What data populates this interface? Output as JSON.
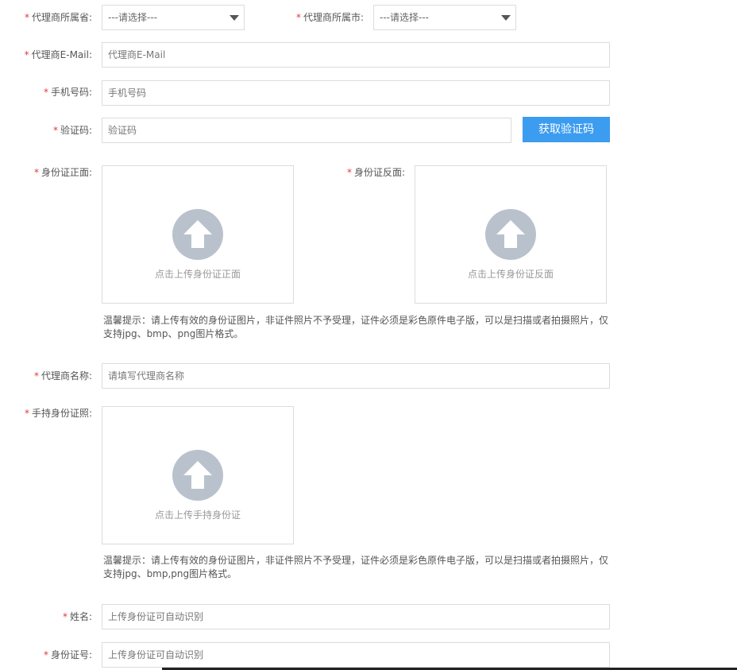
{
  "fields": {
    "province": {
      "label": "代理商所属省:",
      "value": "---请选择---"
    },
    "city": {
      "label": "代理商所属市:",
      "value": "---请选择---"
    },
    "email": {
      "label": "代理商E-Mail:",
      "placeholder": "代理商E-Mail"
    },
    "phone": {
      "label": "手机号码:",
      "placeholder": "手机号码"
    },
    "code": {
      "label": "验证码:",
      "placeholder": "验证码",
      "button": "获取验证码"
    },
    "id_front": {
      "label": "身份证正面:",
      "upload_text": "点击上传身份证正面"
    },
    "id_back": {
      "label": "身份证反面:",
      "upload_text": "点击上传身份证反面"
    },
    "hint1": "温馨提示：请上传有效的身份证图片，非证件照片不予受理，证件必须是彩色原件电子版，可以是扫描或者拍摄照片，仅支持jpg、bmp、png图片格式。",
    "agent_name": {
      "label": "代理商名称:",
      "placeholder": "请填写代理商名称"
    },
    "id_handheld": {
      "label": "手持身份证照:",
      "upload_text": "点击上传手持身份证"
    },
    "hint2": "温馨提示：请上传有效的身份证图片，非证件照片不予受理，证件必须是彩色原件电子版，可以是扫描或者拍摄照片，仅支持jpg、bmp,png图片格式。",
    "name": {
      "label": "姓名:",
      "placeholder": "上传身份证可自动识别"
    },
    "id_number": {
      "label": "身份证号:",
      "placeholder": "上传身份证可自动识别"
    }
  },
  "required_mark": "*",
  "colors": {
    "required": "#e4393c",
    "button": "#3c9cf0",
    "upload_icon": "#b9c2cc"
  }
}
